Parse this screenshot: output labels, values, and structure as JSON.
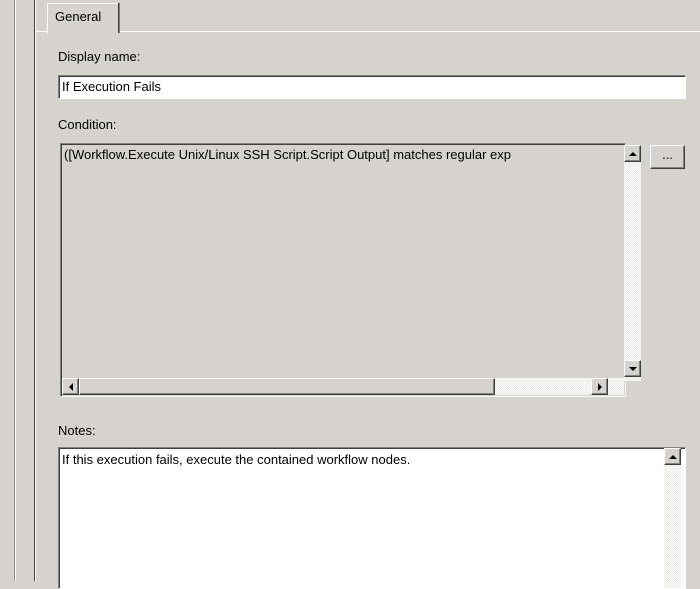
{
  "tabs": [
    {
      "label": "General"
    }
  ],
  "display_name": {
    "label": "Display name:",
    "value": "If Execution Fails"
  },
  "condition": {
    "label": "Condition:",
    "value": "([Workflow.Execute Unix/Linux SSH Script.Script Output] matches regular exp",
    "browse_label": "..."
  },
  "notes": {
    "label": "Notes:",
    "value": "If this execution fails, execute the contained workflow nodes."
  },
  "icons": {
    "up": "scroll-up-arrow-icon",
    "down": "scroll-down-arrow-icon",
    "left": "scroll-left-arrow-icon",
    "right": "scroll-right-arrow-icon"
  },
  "colors": {
    "dialog_bg": "#d6d3ce",
    "field_bg": "#ffffff"
  }
}
